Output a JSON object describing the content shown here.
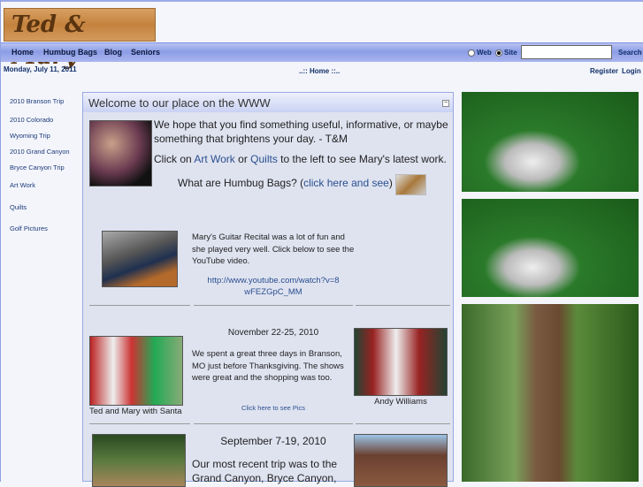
{
  "header": {
    "logo_text": "Ted & Mary"
  },
  "nav": {
    "items": [
      "Home",
      "Humbug Bags",
      "Blog",
      "Seniors"
    ],
    "search_options": [
      "Web",
      "Site"
    ],
    "selected_option": "Site",
    "search_value": "",
    "search_button": "Search"
  },
  "subbar": {
    "date": "Monday, July 11, 2011",
    "breadcrumb": "..:: Home ::..",
    "register": "Register",
    "login": "Login"
  },
  "sidebar": {
    "items": [
      "2010 Branson Trip",
      "2010 Colorado Wyoming Trip",
      "2010 Grand Canyon Bryce Canyon Trip",
      "Art Work",
      "Quilts",
      "Golf Pictures"
    ]
  },
  "panel": {
    "title": "Welcome to our place on the WWW",
    "intro": "We hope that you find something useful, informative, or maybe something that brightens your day. - T&M",
    "click_pre": "Click on ",
    "artwork": "Art Work",
    "or": " or ",
    "quilts": "Quilts",
    "click_post": " to the left to see Mary's latest work.",
    "humbug_pre": "What are Humbug Bags? (",
    "humbug_link": "click here and see",
    "humbug_post": ")",
    "recital": "Mary's Guitar Recital was a lot of fun and she played very well.  Click below to see the YouTube video.",
    "youtube_link": "http://www.youtube.com/watch?v=8wFEZGpC_MM",
    "branson_caption": "Ted and Mary with Santa",
    "branson_date": "November 22-25, 2010",
    "branson_text": "We spent a great three days in Branson, MO just before Thanksgiving. The shows were great and the shopping was too.",
    "branson_link": "Click here to see Pics",
    "andy_caption": "Andy Williams",
    "canyon_date": "September 7-19, 2010",
    "canyon_text": "Our most recent trip was to the Grand Canyon, Bryce Canyon,"
  }
}
